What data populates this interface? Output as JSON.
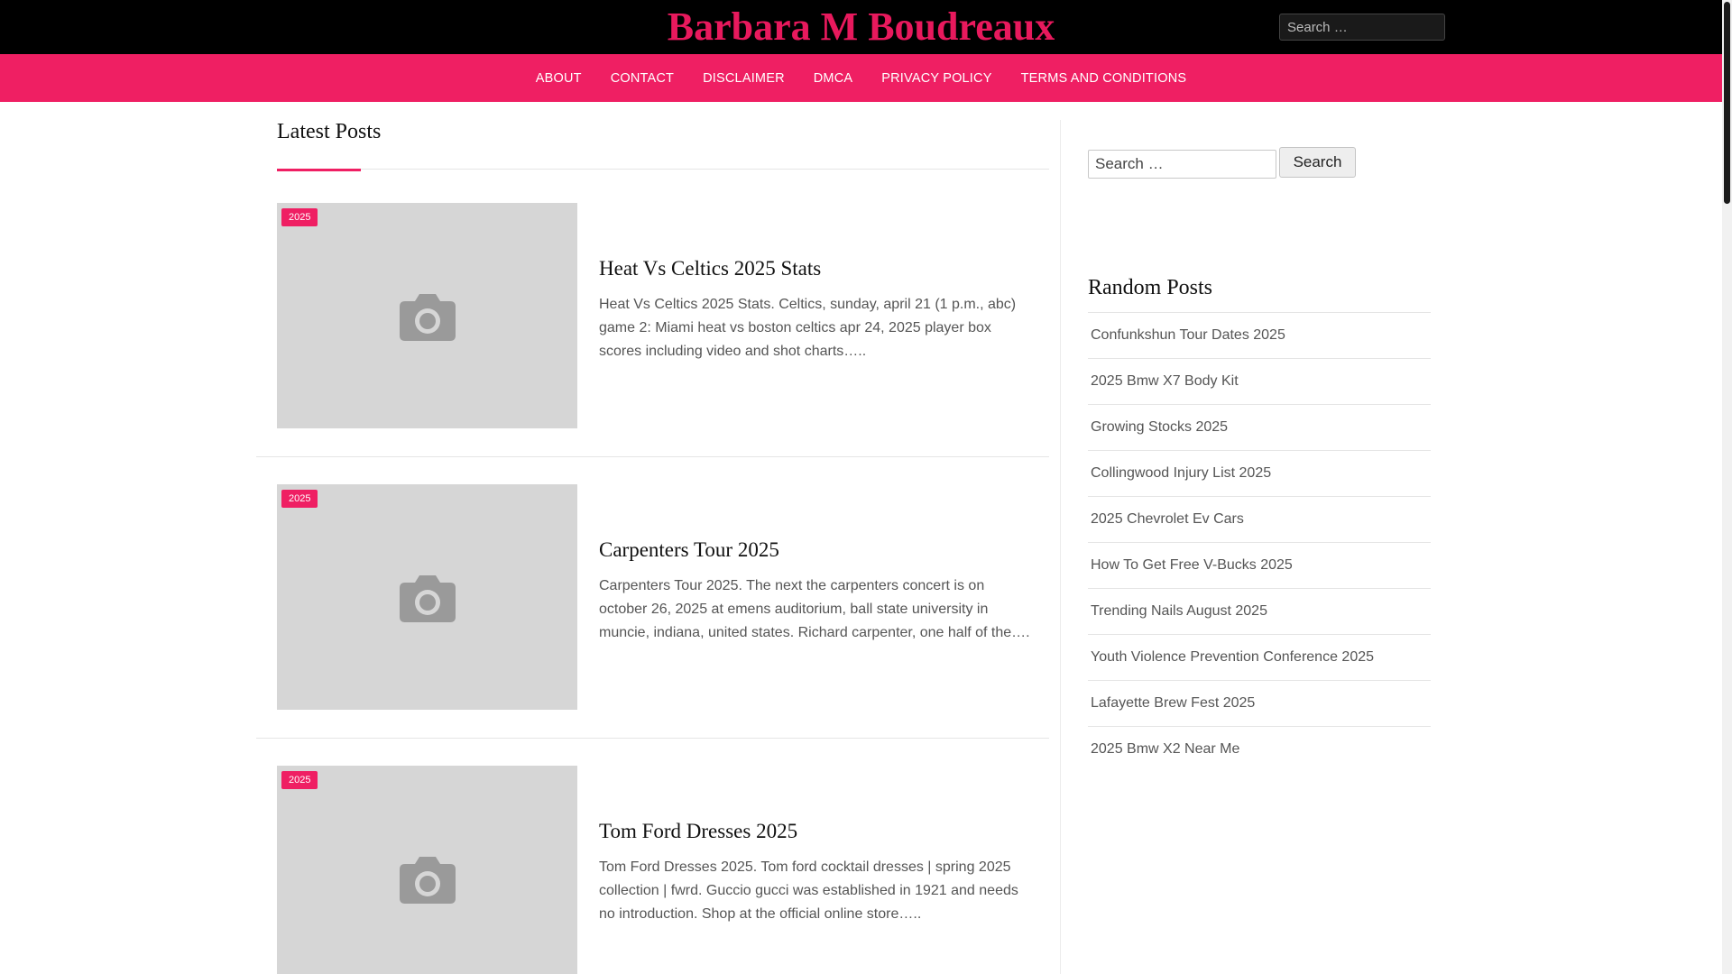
{
  "header": {
    "site_title": "Barbara M Boudreaux",
    "search_placeholder": "Search …"
  },
  "nav": {
    "items": [
      "ABOUT",
      "CONTACT",
      "DISCLAIMER",
      "DMCA",
      "PRIVACY POLICY",
      "TERMS AND CONDITIONS"
    ]
  },
  "main": {
    "section_title": "Latest Posts",
    "posts": [
      {
        "badge": "2025",
        "title": "Heat Vs Celtics 2025 Stats",
        "excerpt": "Heat Vs Celtics 2025 Stats. Celtics, sunday, april 21 (1 p.m., abc) game 2: Miami heat vs boston celtics apr 24, 2025 player box scores including video and shot charts….."
      },
      {
        "badge": "2025",
        "title": "Carpenters Tour 2025",
        "excerpt": "Carpenters Tour 2025. The next the carpenters concert is on october 26, 2025 at emens auditorium, ball state university in muncie, indiana, united states. Richard carpenter, one half of the…."
      },
      {
        "badge": "2025",
        "title": "Tom Ford Dresses 2025",
        "excerpt": "Tom Ford Dresses 2025. Tom ford cocktail dresses | spring 2025 collection | fwrd. Guccio gucci was established in 1921 and needs no introduction. Shop at the official online store….."
      }
    ]
  },
  "sidebar": {
    "search_placeholder": "Search …",
    "search_button": "Search",
    "random_title": "Random Posts",
    "random_posts": [
      "Confunkshun Tour Dates 2025",
      "2025 Bmw X7 Body Kit",
      "Growing Stocks 2025",
      "Collingwood Injury List 2025",
      "2025 Chevrolet Ev Cars",
      "How To Get Free V-Bucks 2025",
      "Trending Nails August 2025",
      "Youth Violence Prevention Conference 2025",
      "Lafayette Brew Fest 2025",
      "2025 Bmw X2 Near Me"
    ]
  },
  "colors": {
    "accent": "#ef1f63",
    "title_pink": "#e8195d",
    "header_bg": "#000000",
    "thumb_bg": "#d6d6d6"
  },
  "icons": {
    "thumbnail": "camera-icon"
  }
}
